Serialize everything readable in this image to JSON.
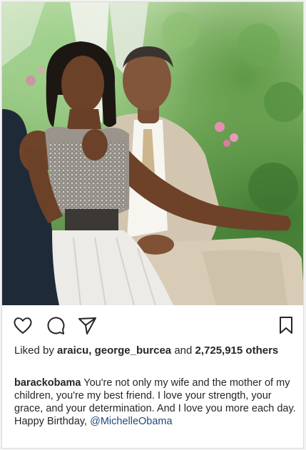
{
  "post": {
    "image_alt": "",
    "colors": {
      "text": "#262626",
      "mention": "#1e4a7a",
      "border": "#dbdbdb"
    }
  },
  "actions": {
    "like_icon": "heart-icon",
    "comment_icon": "comment-icon",
    "share_icon": "share-icon",
    "save_icon": "bookmark-icon"
  },
  "likes": {
    "prefix": "Liked by",
    "user1": "araicu",
    "user2": "george_burcea",
    "conj": "and",
    "count": "2,725,915 others"
  },
  "caption": {
    "username": "barackobama",
    "text": "You're not only my wife and the mother of my children, you're my best friend. I love your strength, your grace, and your determination. And I love you more each day. Happy Birthday,",
    "mention": "@MichelleObama"
  }
}
